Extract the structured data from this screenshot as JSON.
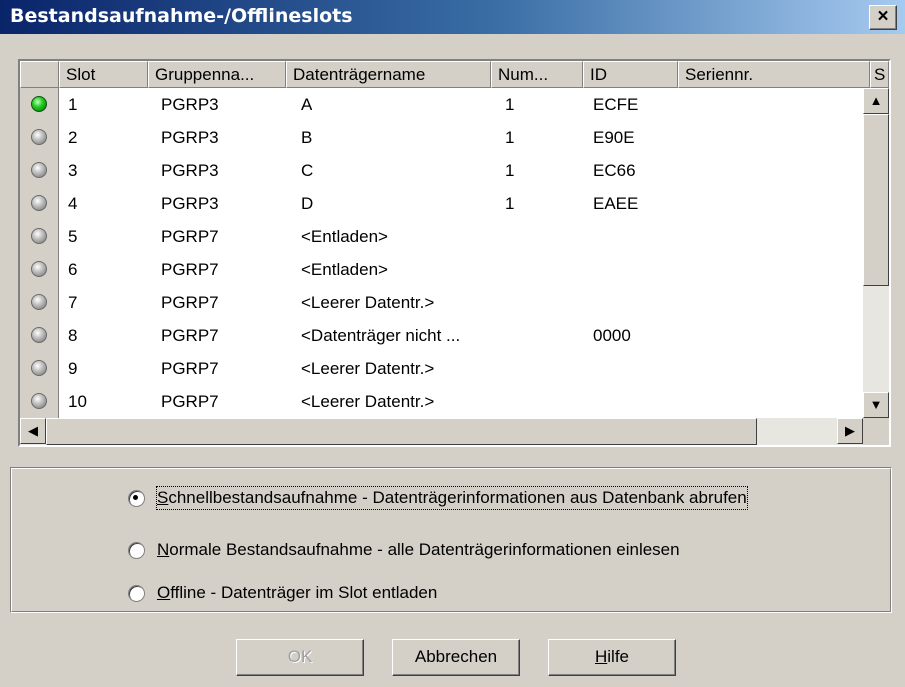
{
  "window": {
    "title": "Bestandsaufnahme-/Offlineslots",
    "close_label": "×"
  },
  "table": {
    "columns": [
      "",
      "Slot",
      "Gruppenna...",
      "Datenträgername",
      "Num...",
      "ID",
      "Seriennr.",
      "S"
    ],
    "rows": [
      {
        "status": "green",
        "slot": "1",
        "group": "PGRP3",
        "name": "A",
        "num": "1",
        "id": "ECFE",
        "serial": ""
      },
      {
        "status": "gray",
        "slot": "2",
        "group": "PGRP3",
        "name": "B",
        "num": "1",
        "id": "E90E",
        "serial": ""
      },
      {
        "status": "gray",
        "slot": "3",
        "group": "PGRP3",
        "name": "C",
        "num": "1",
        "id": "EC66",
        "serial": ""
      },
      {
        "status": "gray",
        "slot": "4",
        "group": "PGRP3",
        "name": "D",
        "num": "1",
        "id": "EAEE",
        "serial": ""
      },
      {
        "status": "gray",
        "slot": "5",
        "group": "PGRP7",
        "name": "<Entladen>",
        "num": "",
        "id": "",
        "serial": ""
      },
      {
        "status": "gray",
        "slot": "6",
        "group": "PGRP7",
        "name": "<Entladen>",
        "num": "",
        "id": "",
        "serial": ""
      },
      {
        "status": "gray",
        "slot": "7",
        "group": "PGRP7",
        "name": "<Leerer Datentr.>",
        "num": "",
        "id": "",
        "serial": ""
      },
      {
        "status": "gray",
        "slot": "8",
        "group": "PGRP7",
        "name": "<Datenträger nicht ...",
        "num": "",
        "id": "0000",
        "serial": ""
      },
      {
        "status": "gray",
        "slot": "9",
        "group": "PGRP7",
        "name": "<Leerer Datentr.>",
        "num": "",
        "id": "",
        "serial": ""
      },
      {
        "status": "gray",
        "slot": "10",
        "group": "PGRP7",
        "name": "<Leerer Datentr.>",
        "num": "",
        "id": "",
        "serial": ""
      }
    ]
  },
  "options": {
    "quick": {
      "underline": "S",
      "rest": "chnellbestandsaufnahme - Datenträgerinformationen aus Datenbank abrufen",
      "checked": true
    },
    "normal": {
      "underline": "N",
      "rest": "ormale Bestandsaufnahme - alle Datenträgerinformationen einlesen",
      "checked": false
    },
    "offline": {
      "underline": "O",
      "rest": "ffline - Datenträger im Slot entladen",
      "checked": false
    }
  },
  "buttons": {
    "ok": "OK",
    "cancel": "Abbrechen",
    "help_underline": "H",
    "help_rest": "ilfe"
  },
  "icons": {
    "scroll_up": "arrow-up-icon",
    "scroll_down": "arrow-down-icon",
    "scroll_left": "arrow-left-icon",
    "scroll_right": "arrow-right-icon"
  },
  "colors": {
    "title_bar": "#0a246a",
    "status_green": "#22d022",
    "face": "#d4d0c8"
  }
}
